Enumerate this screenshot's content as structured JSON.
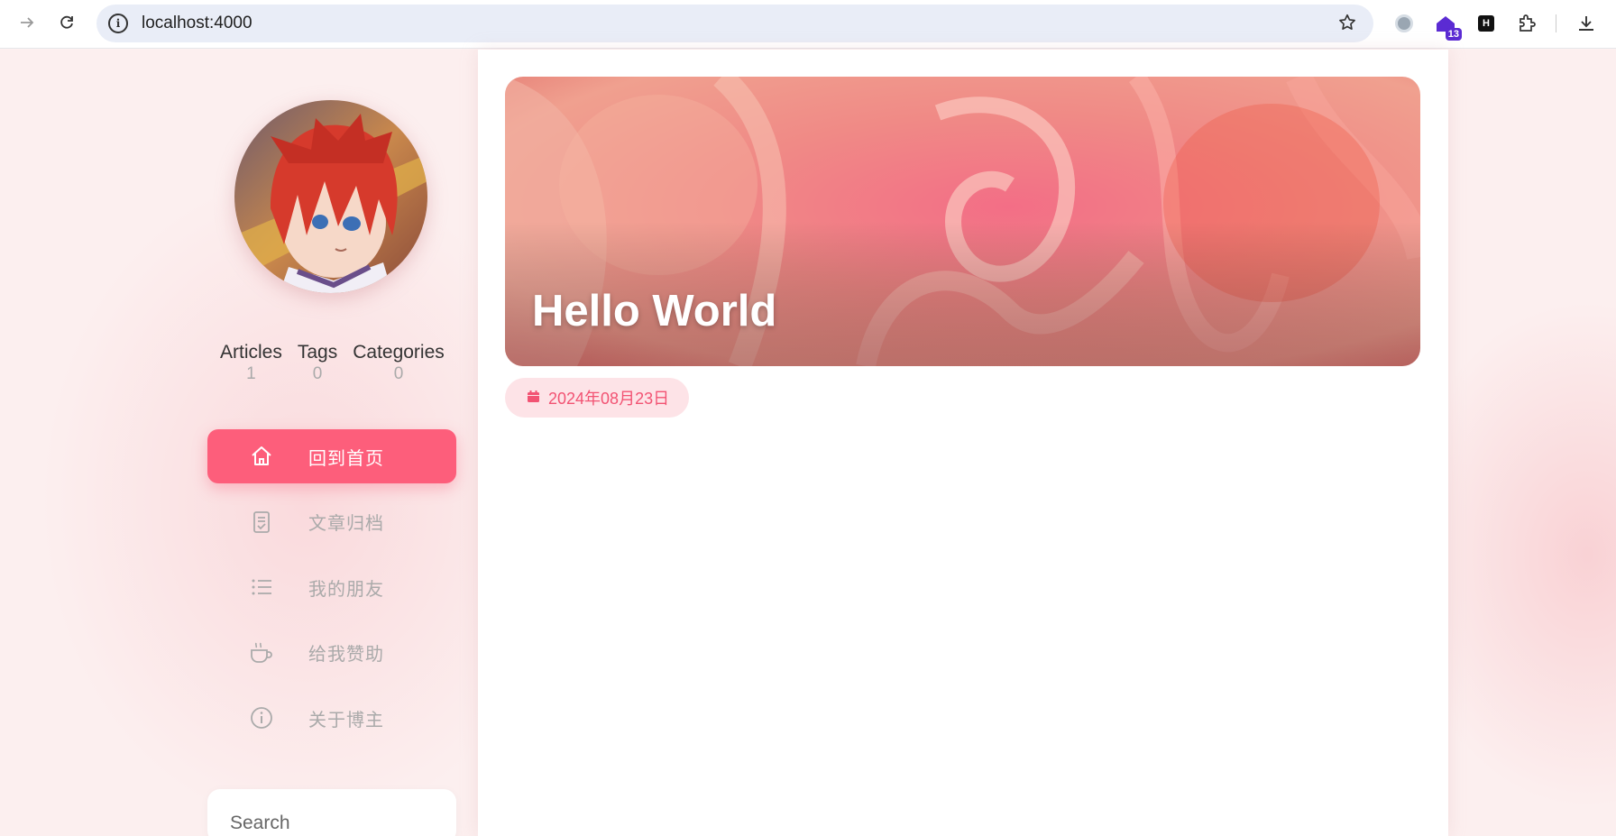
{
  "browser": {
    "url": "localhost:4000",
    "extension_badge": "13",
    "extension_h": "H"
  },
  "profile": {
    "stats": [
      {
        "label": "Articles",
        "value": "1"
      },
      {
        "label": "Tags",
        "value": "0"
      },
      {
        "label": "Categories",
        "value": "0"
      }
    ]
  },
  "menu": [
    {
      "label": "回到首页",
      "icon": "home-icon",
      "active": true
    },
    {
      "label": "文章归档",
      "icon": "document-icon",
      "active": false
    },
    {
      "label": "我的朋友",
      "icon": "list-icon",
      "active": false
    },
    {
      "label": "给我赞助",
      "icon": "coffee-icon",
      "active": false
    },
    {
      "label": "关于博主",
      "icon": "info-icon",
      "active": false
    }
  ],
  "search": {
    "placeholder": "Search"
  },
  "post": {
    "title": "Hello World",
    "date": "2024年08月23日"
  },
  "colors": {
    "accent": "#fd5e7b",
    "date_text": "#f25373",
    "date_bg": "#fde3e7"
  }
}
